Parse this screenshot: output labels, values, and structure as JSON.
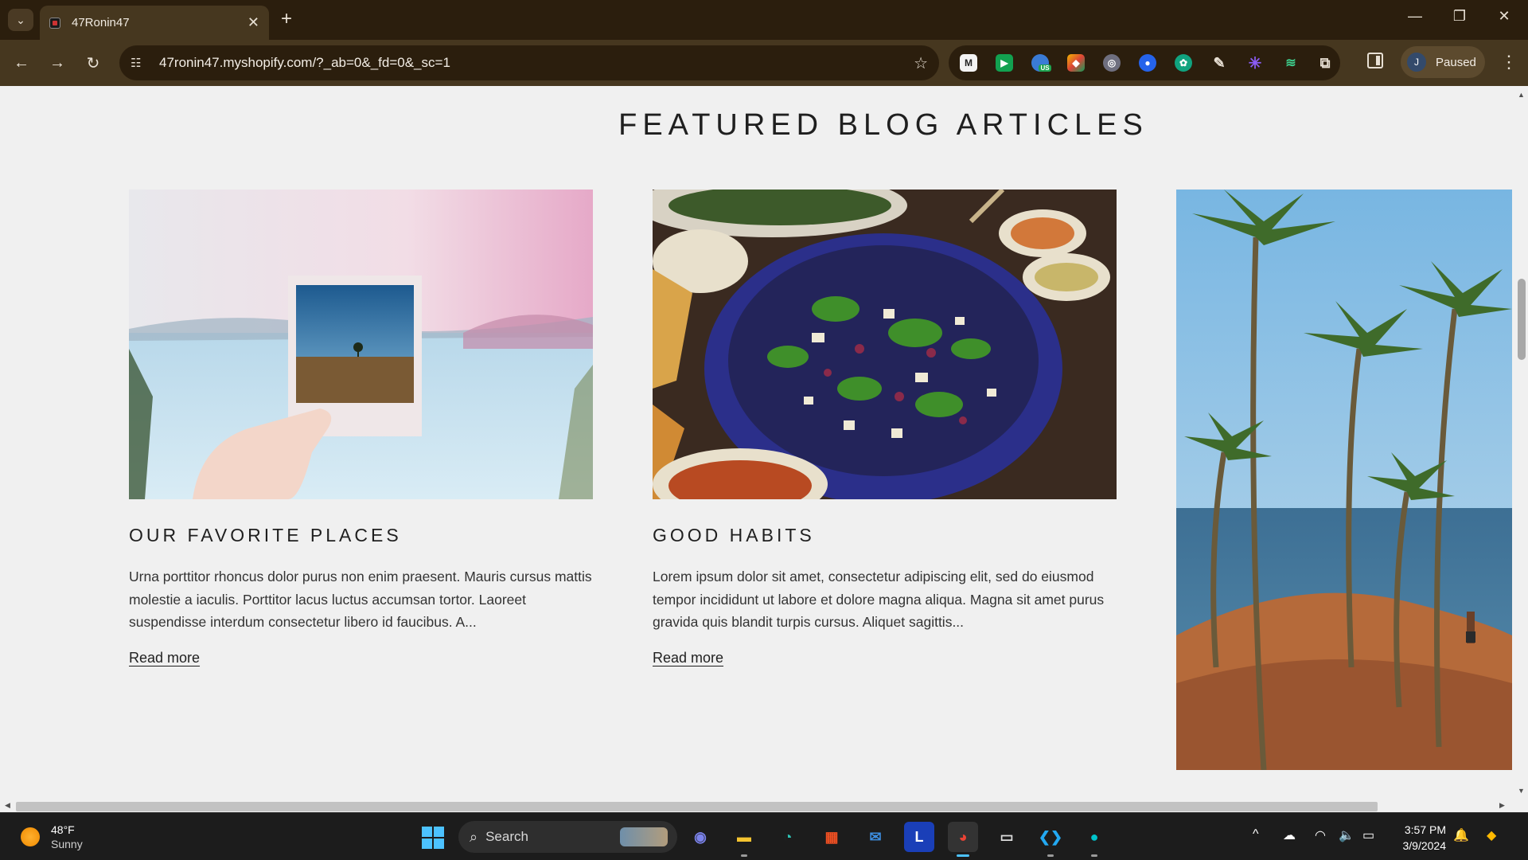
{
  "browser": {
    "tab_title": "47Ronin47",
    "url": "47ronin47.myshopify.com/?_ab=0&_fd=0&_sc=1",
    "profile_initial": "J",
    "profile_status": "Paused",
    "extension_badge": "US"
  },
  "page": {
    "section_title": "FEATURED BLOG ARTICLES",
    "articles": [
      {
        "title": "OUR FAVORITE PLACES",
        "excerpt": "Urna porttitor rhoncus dolor purus non enim praesent. Mauris cursus mattis molestie a iaculis. Porttitor lacus luctus accumsan tortor. Laoreet suspendisse interdum consectetur libero id faucibus. A...",
        "link": "Read more",
        "image": "polaroid-photo-lake"
      },
      {
        "title": "GOOD HABITS",
        "excerpt": "Lorem ipsum dolor sit amet, consectetur adipiscing elit, sed do eiusmod tempor incididunt ut labore et dolore magna aliqua. Magna sit amet purus gravida quis blandit turpis cursus. Aliquet sagittis...",
        "link": "Read more",
        "image": "salad-bowl"
      },
      {
        "image": "palm-trees-beach"
      }
    ]
  },
  "taskbar": {
    "weather_temp": "48°F",
    "weather_cond": "Sunny",
    "search_placeholder": "Search",
    "time": "3:57 PM",
    "date": "3/9/2024"
  }
}
